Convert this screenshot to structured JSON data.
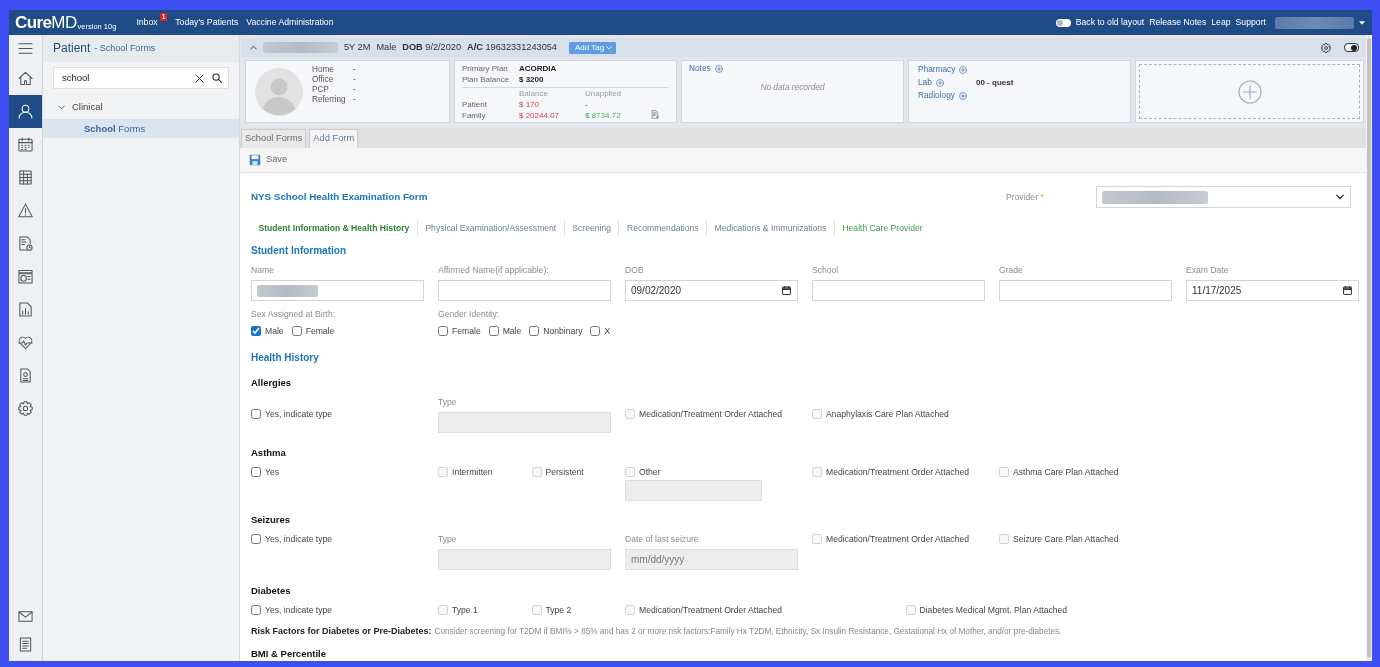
{
  "top_nav": {
    "logo": "**Cure**MD",
    "version": "version 10g",
    "links": [
      {
        "label": "Inbox",
        "badge": "1"
      },
      {
        "label": "Today's Patients"
      },
      {
        "label": "Vaccine Administration"
      }
    ],
    "layout_toggle": {
      "label": "Back to old layout",
      "on": false
    },
    "right_links": [
      "Release Notes",
      "Leap",
      "Support"
    ]
  },
  "icon_rail": {
    "items": [
      {
        "kind": "menu",
        "selected": false
      },
      {
        "kind": "home",
        "selected": false
      },
      {
        "kind": "patient",
        "selected": true
      },
      {
        "kind": "calendar",
        "selected": false
      },
      {
        "kind": "grid",
        "selected": false
      },
      {
        "kind": "alert",
        "selected": false
      },
      {
        "kind": "clockdoc",
        "selected": false
      },
      {
        "kind": "cash",
        "selected": false
      },
      {
        "kind": "report",
        "selected": false
      },
      {
        "kind": "health",
        "selected": false
      },
      {
        "kind": "form",
        "selected": false
      },
      {
        "kind": "settings",
        "selected": false
      }
    ],
    "bottom_items": [
      {
        "kind": "mail",
        "selected": false
      },
      {
        "kind": "notes",
        "selected": false
      }
    ]
  },
  "patient_pane": {
    "title": "Patient",
    "subtitle": "- School Forms",
    "search": {
      "value": "school"
    },
    "tree": [
      {
        "label": "Clinical",
        "expanded": true,
        "selected": false,
        "children": [
          {
            "label": "**School** Forms",
            "selected": true
          }
        ]
      }
    ]
  },
  "patient_header": {
    "age": "5Y 2M",
    "sex": "Male",
    "dob_label": "DOB",
    "dob": "9/2/2020",
    "account_label": "A/C",
    "account": "19632331243054",
    "add_tag": "Add Tag",
    "view_toggle": {
      "on": true
    }
  },
  "contact_card": {
    "rows": [
      {
        "label": "Home",
        "info": "-"
      },
      {
        "label": "Office",
        "info": "-"
      },
      {
        "label": "PCP",
        "info": "-"
      },
      {
        "label": "Referring",
        "info": "-"
      }
    ]
  },
  "insurance_card": {
    "plan_rows": [
      {
        "label": "Primary Plan",
        "value": "ACORDIA"
      },
      {
        "label": "Plan Balance",
        "value": "$ 3200"
      }
    ],
    "columns": [
      "Balance",
      "Unapplied"
    ],
    "rows": [
      {
        "label": "Patient",
        "balance": "$ 170",
        "unapplied": "-"
      },
      {
        "label": "Family",
        "balance": "$ 20244.07",
        "unapplied": "$ 8734.72"
      }
    ]
  },
  "notes_card": {
    "title": "Notes",
    "empty_text": "No data recorded"
  },
  "orders_card": {
    "rows": [
      {
        "label": "Pharmacy"
      },
      {
        "label": "Lab",
        "value": "00 - quest"
      },
      {
        "label": "Radiology"
      }
    ]
  },
  "tabs": [
    {
      "label": "School Forms",
      "selected": false
    },
    {
      "label": "Add Form",
      "selected": true
    }
  ],
  "toolbar": {
    "save": "Save"
  },
  "form": {
    "title": "NYS School Health Examination Form",
    "provider": {
      "label": "Provider",
      "required_mark": "*"
    },
    "sections": [
      {
        "label": "Student Information & Health History",
        "selected": true,
        "highlighted": true
      },
      {
        "label": "Physical Examination/Assessment",
        "selected": false,
        "highlighted": false
      },
      {
        "label": "Screening",
        "selected": false,
        "highlighted": false
      },
      {
        "label": "Recommendations",
        "selected": false,
        "highlighted": false
      },
      {
        "label": "Medications & Immunizations",
        "selected": false,
        "highlighted": false
      },
      {
        "label": "Health Care Provider",
        "selected": false,
        "highlighted": true
      }
    ],
    "student_information": {
      "heading": "Student Information",
      "fields": [
        {
          "label": "Name",
          "kind": "redacted"
        },
        {
          "label": "Affirmed Name(if applicable):",
          "kind": "text"
        },
        {
          "label": "DOB",
          "kind": "date",
          "value": "09/02/2020"
        },
        {
          "label": "School",
          "kind": "text"
        },
        {
          "label": "Grade",
          "kind": "text"
        },
        {
          "label": "Exam Date",
          "kind": "date",
          "value": "11/17/2025"
        }
      ],
      "option_groups": [
        {
          "label": "Sex Assigned at Birth:",
          "options": [
            {
              "label": "Male",
              "checked": true
            },
            {
              "label": "Female",
              "checked": false
            }
          ]
        },
        {
          "label": "Gender Identity:",
          "options": [
            {
              "label": "Female",
              "checked": false
            },
            {
              "label": "Male",
              "checked": false
            },
            {
              "label": "Nonbinary",
              "checked": false
            },
            {
              "label": "X",
              "checked": false
            }
          ]
        }
      ]
    },
    "health_history": {
      "heading": "Health History",
      "groups": [
        {
          "title": "Allergies",
          "items": [
            {
              "kind": "checkbox",
              "label": "Yes, indicate type",
              "checked": false,
              "disabled": false
            },
            {
              "kind": "input",
              "label": "Type",
              "disabled": true
            },
            {
              "kind": "checkbox",
              "label": "Medication/Treatment Order Attached",
              "checked": false,
              "disabled": true
            },
            {
              "kind": "checkbox",
              "label": "Anaphylaxis Care Plan Attached",
              "checked": false,
              "disabled": true
            }
          ]
        },
        {
          "title": "Asthma",
          "items": [
            {
              "kind": "checkbox",
              "label": "Yes",
              "checked": false,
              "disabled": false
            },
            {
              "kind": "checkbox",
              "label": "Intermitten",
              "checked": false,
              "disabled": true
            },
            {
              "kind": "checkbox",
              "label": "Persistent",
              "checked": false,
              "disabled": true
            },
            {
              "kind": "checkinput",
              "label": "Other",
              "checked": false,
              "disabled": true
            },
            {
              "kind": "checkbox",
              "label": "Medication/Treatment Order Attached",
              "checked": false,
              "disabled": true
            },
            {
              "kind": "checkbox",
              "label": "Asthma Care Plan Attached",
              "checked": false,
              "disabled": true
            }
          ]
        },
        {
          "title": "Seizures",
          "items": [
            {
              "kind": "checkbox",
              "label": "Yes, indicate type",
              "checked": false,
              "disabled": false
            },
            {
              "kind": "input",
              "label": "Type",
              "disabled": true
            },
            {
              "kind": "input",
              "label": "Date of last seizure",
              "placeholder": "mm/dd/yyyy",
              "disabled": true
            },
            {
              "kind": "checkbox",
              "label": "Medication/Treatment Order Attached",
              "checked": false,
              "disabled": true
            },
            {
              "kind": "checkbox",
              "label": "Seizure Care Plan Attached",
              "checked": false,
              "disabled": true
            }
          ]
        },
        {
          "title": "Diabetes",
          "items": [
            {
              "kind": "checkbox",
              "label": "Yes, indicate type",
              "checked": false,
              "disabled": false
            },
            {
              "kind": "checkbox",
              "label": "Type 1",
              "checked": false,
              "disabled": true
            },
            {
              "kind": "checkbox",
              "label": "Type 2",
              "checked": false,
              "disabled": true
            },
            {
              "kind": "checkbox",
              "label": "Medication/Treatment Order Attached",
              "checked": false,
              "disabled": true
            },
            {
              "kind": "checkbox",
              "label": "Diabetes Medical Mgmt. Plan Attached",
              "checked": false,
              "disabled": true
            }
          ],
          "note": {
            "label": "Risk Factors for Diabetes or Pre-Diabetes:",
            "text": "Consider screening for T2DM if BMI% > 85% and has 2 or more risk factors:Family Hx T2DM, Ethnicity, Sx Insulin Resistance, Gestational Hx of Mother, and/or pre-diabetes."
          }
        },
        {
          "title": "BMI & Percentile"
        }
      ]
    }
  }
}
